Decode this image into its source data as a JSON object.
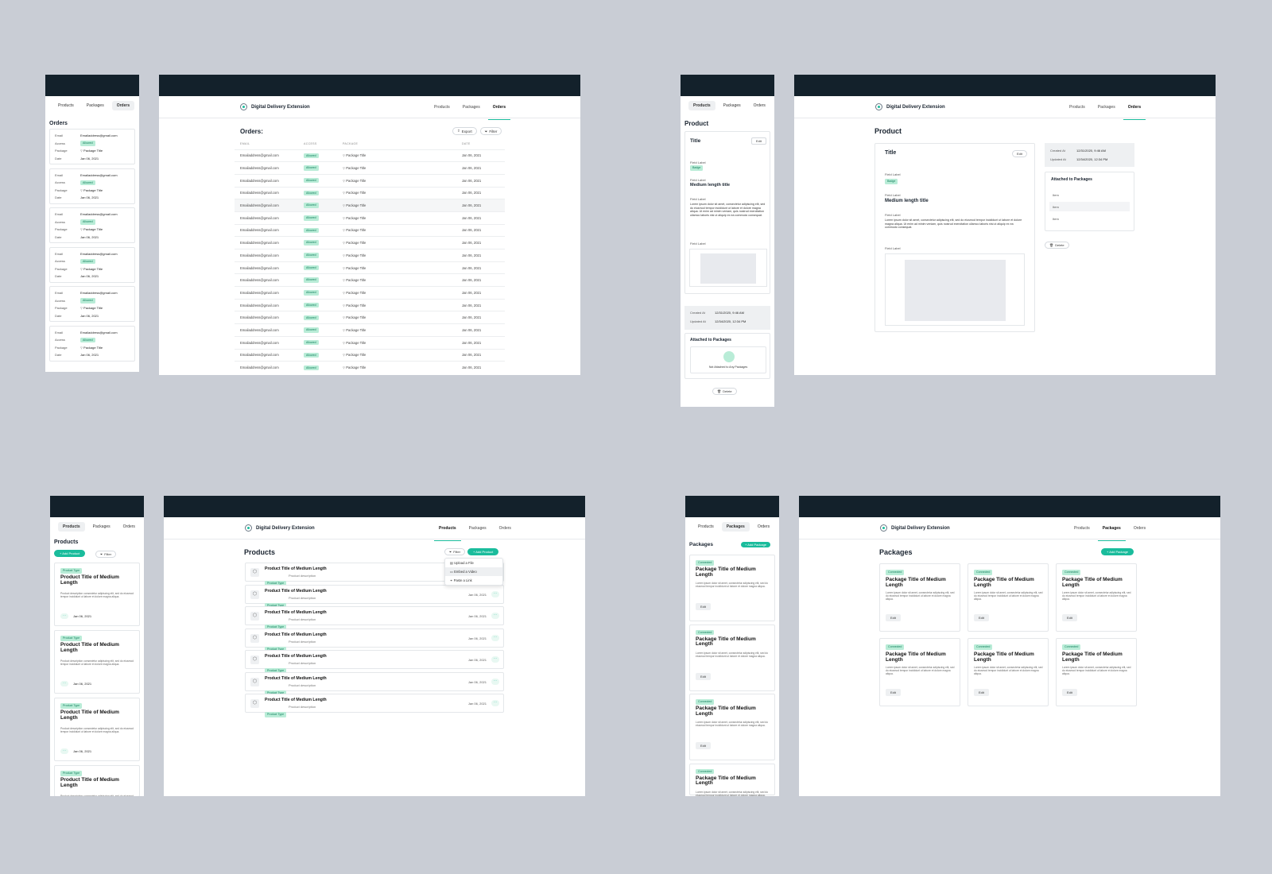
{
  "app": {
    "name": "Digital Delivery Extension"
  },
  "nav": {
    "products": "Products",
    "packages": "Packages",
    "orders": "Orders"
  },
  "orders": {
    "title": "Orders",
    "desktop_title": "Orders:",
    "export_label": "Export",
    "filter_label": "Filter",
    "columns": {
      "email": "EMAIL",
      "access": "ACCESS",
      "package": "PACKAGE",
      "date": "DATE"
    },
    "row": {
      "email": "Emailaddress@gmail.com",
      "access": "Allowed",
      "package": "Package Title",
      "date": "Jan 06, 2021"
    },
    "row_count": 18,
    "mobile_labels": {
      "email": "Email",
      "access": "Access",
      "package": "Package",
      "date": "Date"
    },
    "mobile_card_count": 6
  },
  "product": {
    "title": "Product",
    "card_title": "Title",
    "edit_label": "Edit",
    "field_label": "Field Label",
    "badge": "Badge",
    "medium_title": "Medium length title",
    "paragraph": "Lorem ipsum dolor sit amet, consectetur adipiscing elit, sed do eiusmod tempor incididunt ut labore et dolore magna aliqua. Ut enim ad minim veniam, quis nostrud exercitation ullamco laboris nisi ut aliquip ex ea commodo consequat.",
    "created_label": "Created At",
    "created_value": "12/31/2020, 9:46 AM",
    "updated_label": "Updated At",
    "updated_value": "12/34/2020, 12:34 PM",
    "attached_title": "Attached to Packages",
    "not_attached": "Not Attached to Any Packages",
    "items": [
      "Item",
      "Item",
      "Item"
    ],
    "delete_label": "Delete"
  },
  "products": {
    "title": "Products",
    "add_label": "+ Add Product",
    "filter_label": "Filter",
    "item_title": "Product Title of Medium Length",
    "type_badge": "Product Type",
    "description": "Product description",
    "mobile_description": "Product description consectetur adipiscing elit, sed do eiusmod tempor incididunt ut labore et dolore magna aliqua.",
    "date": "Jan 06, 2021",
    "menu": [
      "Upload a File",
      "Embed a Video",
      "Paste a Link"
    ],
    "row_count": 7
  },
  "packages": {
    "title": "Packages",
    "add_label": "+ Add Package",
    "badge": "Connected",
    "item_title": "Package Title of Medium Length",
    "description": "Lorem ipsum dolor sit amet, consectetur adipiscing elit, sed do eiusmod tempor incididunt ut labore et dolore magna aliqua.",
    "edit_label": "Edit"
  },
  "colors": {
    "background": "#c9cdd5",
    "topbar": "#13212b",
    "accent": "#1abc9c",
    "badge_bg": "#b9ecd7",
    "badge_text": "#13805e"
  },
  "icons": {
    "logo": "logo-icon",
    "export": "export-icon",
    "filter": "filter-icon",
    "package": "package-icon",
    "product": "box-icon",
    "delete": "trash-icon",
    "more": "more-dots-icon"
  }
}
